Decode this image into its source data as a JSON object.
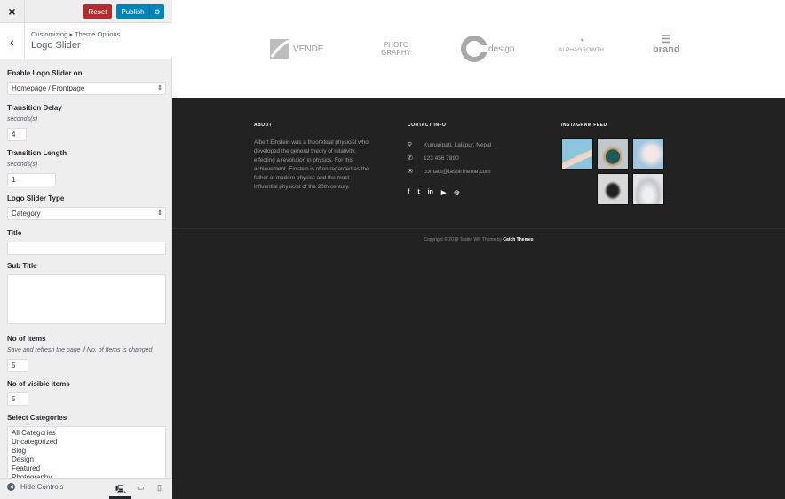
{
  "header": {
    "close_icon": "×",
    "reset_label": "Reset",
    "publish_label": "Publish",
    "gear_icon": "⚙",
    "back_icon": "‹",
    "breadcrumb": "Customizing ▸ Theme Options",
    "section_title": "Logo Slider"
  },
  "controls": {
    "enable_label": "Enable Logo Slider on",
    "enable_value": "Homepage / Frontpage",
    "delay_label": "Transition Delay",
    "delay_unit": "seconds(s)",
    "delay_value": "4",
    "length_label": "Transition Length",
    "length_unit": "seconds(s)",
    "length_value": "1",
    "type_label": "Logo Slider Type",
    "type_value": "Category",
    "title_label": "Title",
    "title_value": "",
    "subtitle_label": "Sub Title",
    "subtitle_value": "",
    "items_label": "No of Items",
    "items_desc": "Save and refresh the page if No. of Items is changed",
    "items_value": "5",
    "visible_label": "No of visible items",
    "visible_value": "5",
    "categories_label": "Select Categories",
    "categories": [
      "All Categories",
      "Uncategorized",
      "Blog",
      "Design",
      "Featured",
      "Photography"
    ]
  },
  "footer_bar": {
    "hide_controls": "Hide Controls",
    "devices": [
      "desktop",
      "tablet",
      "mobile"
    ],
    "active_device": "desktop"
  },
  "preview": {
    "logos": [
      "VENDE",
      "PHOTO GRAPHY",
      "design",
      "ALPHAGROWTH",
      "brand"
    ],
    "about_title": "ABOUT",
    "about_text": "Albert Einstein was a theoretical physicist who developed the general theory of relativity, effecting a revolution in physics. For this achievement, Einstein is often regarded as the father of modern physics and the most influential physicist of the 20th century.",
    "contact_title": "CONTACT INFO",
    "contact": {
      "address": "Kumaripati, Lalitpur, Nepal",
      "phone": "123 456 7890",
      "email": "contact@tasbirtheme.com"
    },
    "social": [
      "f",
      "t",
      "in",
      "▶",
      "◎"
    ],
    "instagram_title": "INSTAGRAM FEED",
    "instagram_count": 5,
    "copyright_prefix": "Copyright © 2019 Tasbir. WP Theme by ",
    "copyright_link": "Catch Themes"
  },
  "colors": {
    "reset": "#b32d2e",
    "publish": "#0085ba",
    "footer_bg": "#222222"
  }
}
